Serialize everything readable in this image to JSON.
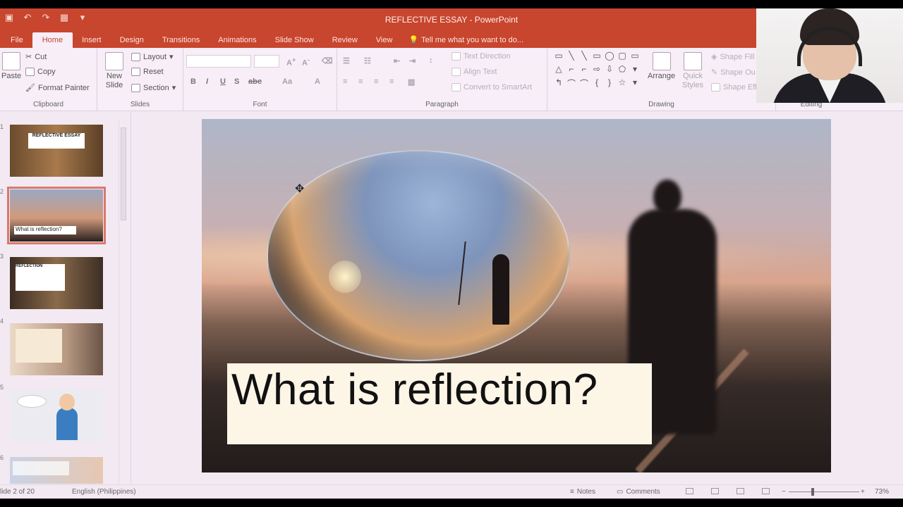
{
  "window": {
    "title": "REFLECTIVE ESSAY - PowerPoint"
  },
  "tabs": [
    "File",
    "Home",
    "Insert",
    "Design",
    "Transitions",
    "Animations",
    "Slide Show",
    "Review",
    "View"
  ],
  "tell_me": "Tell me what you want to do...",
  "ribbon": {
    "clipboard": {
      "paste": "Paste",
      "cut": "Cut",
      "copy": "Copy",
      "format_painter": "Format Painter",
      "label": "Clipboard"
    },
    "slides": {
      "new_slide": "New Slide",
      "layout": "Layout",
      "reset": "Reset",
      "section": "Section",
      "label": "Slides"
    },
    "font": {
      "bold": "B",
      "italic": "I",
      "underline": "U",
      "strike": "S",
      "aa": "Aa",
      "label": "Font"
    },
    "paragraph": {
      "text_direction": "Text Direction",
      "align_text": "Align Text",
      "convert": "Convert to SmartArt",
      "label": "Paragraph"
    },
    "drawing": {
      "arrange": "Arrange",
      "quick_styles": "Quick Styles",
      "shape_fill": "Shape Fill",
      "shape_outline": "Shape Ou",
      "shape_effects": "Shape Eff",
      "label": "Drawing"
    },
    "editing": {
      "label": "Editing"
    }
  },
  "thumbnails": [
    {
      "num": "1",
      "text": "REFLECTIVE ESSAY"
    },
    {
      "num": "2",
      "text": "What is reflection?"
    },
    {
      "num": "3",
      "text": "REFLECTION"
    },
    {
      "num": "4",
      "text": ""
    },
    {
      "num": "5",
      "text": ""
    },
    {
      "num": "6",
      "text": ""
    }
  ],
  "slide": {
    "caption": "What is reflection?"
  },
  "status": {
    "slide_count": "lide 2 of 20",
    "language": "English (Philippines)",
    "notes": "Notes",
    "comments": "Comments",
    "zoom": "73%"
  }
}
